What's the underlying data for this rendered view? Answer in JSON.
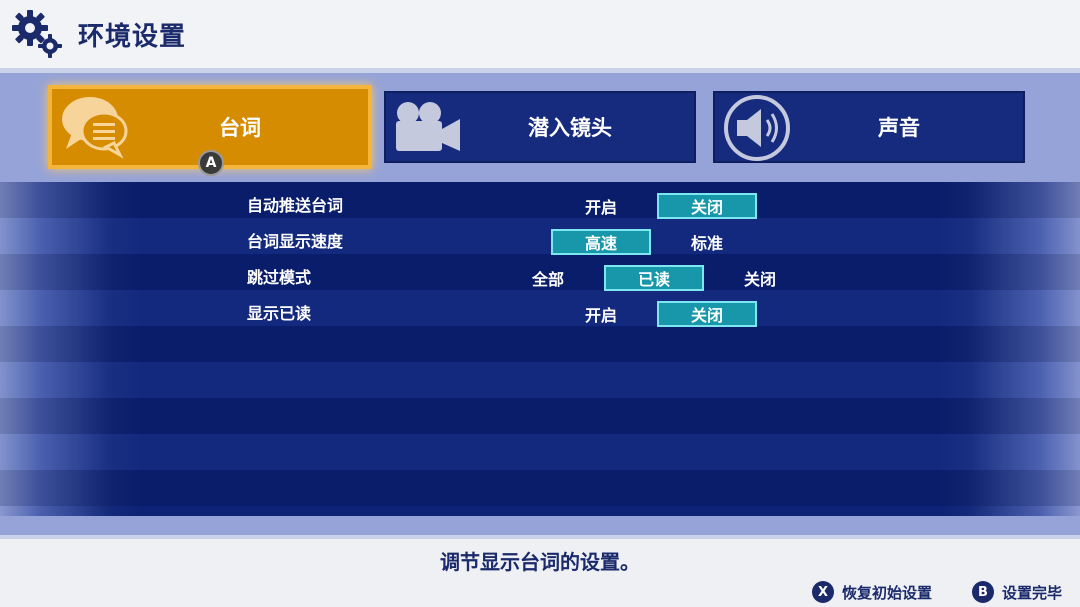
{
  "header": {
    "title": "环境设置",
    "icon": "gear-icon"
  },
  "tabs": [
    {
      "label": "台词",
      "icon": "speech-bubble-icon",
      "active": true
    },
    {
      "label": "潜入镜头",
      "icon": "movie-camera-icon",
      "active": false
    },
    {
      "label": "声音",
      "icon": "speaker-icon",
      "active": false
    }
  ],
  "tab_hint_button": "A",
  "settings": [
    {
      "label": "自动推送台词",
      "options": [
        "开启",
        "关闭"
      ],
      "selected": "关闭"
    },
    {
      "label": "台词显示速度",
      "options": [
        "高速",
        "标准"
      ],
      "selected": "高速"
    },
    {
      "label": "跳过模式",
      "options": [
        "全部",
        "已读",
        "关闭"
      ],
      "selected": "已读"
    },
    {
      "label": "显示已读",
      "options": [
        "开启",
        "关闭"
      ],
      "selected": "关闭"
    }
  ],
  "footer": {
    "hint": "调节显示台词的设置。",
    "controls": [
      {
        "button": "X",
        "label": "恢复初始设置"
      },
      {
        "button": "B",
        "label": "设置完毕"
      }
    ]
  },
  "colors": {
    "accent": "#d58c00",
    "selected_option": "#1797a9",
    "panel_blue": "#0d2275",
    "text_dark": "#1b2a6b"
  }
}
